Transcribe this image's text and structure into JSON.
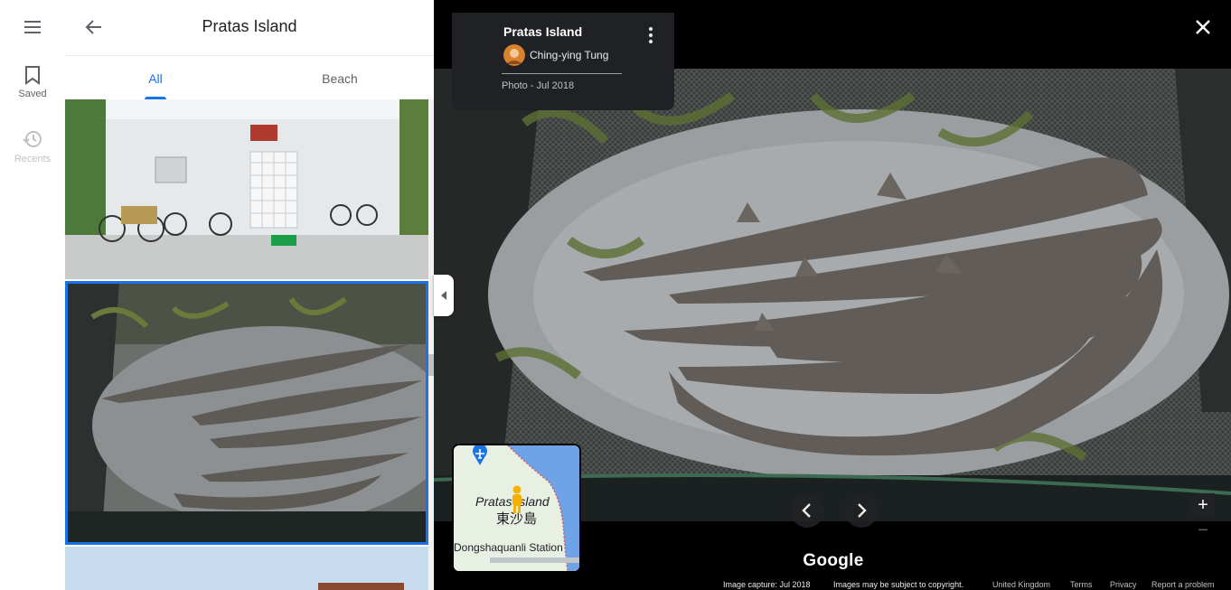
{
  "rail": {
    "saved_label": "Saved",
    "recents_label": "Recents"
  },
  "panel": {
    "title": "Pratas Island",
    "tabs": [
      {
        "label": "All",
        "active": true
      },
      {
        "label": "Beach",
        "active": false
      }
    ]
  },
  "viewer": {
    "place_title": "Pratas Island",
    "author": "Ching-ying Tung",
    "photo_date": "Photo - Jul 2018"
  },
  "minimap": {
    "label_en": "Pratas Island",
    "label_zh": "東沙島",
    "station": "Dongshaquanli Station"
  },
  "zoom": {
    "in": "+",
    "out": "−"
  },
  "branding": "Google",
  "footer": {
    "capture": "Image capture: Jul 2018",
    "copyright": "Images may be subject to copyright.",
    "region": "United Kingdom",
    "terms": "Terms",
    "privacy": "Privacy",
    "report": "Report a problem"
  },
  "colors": {
    "accent": "#1a73e8",
    "map_water": "#6ea3e8",
    "map_land": "#e8f0e4"
  }
}
